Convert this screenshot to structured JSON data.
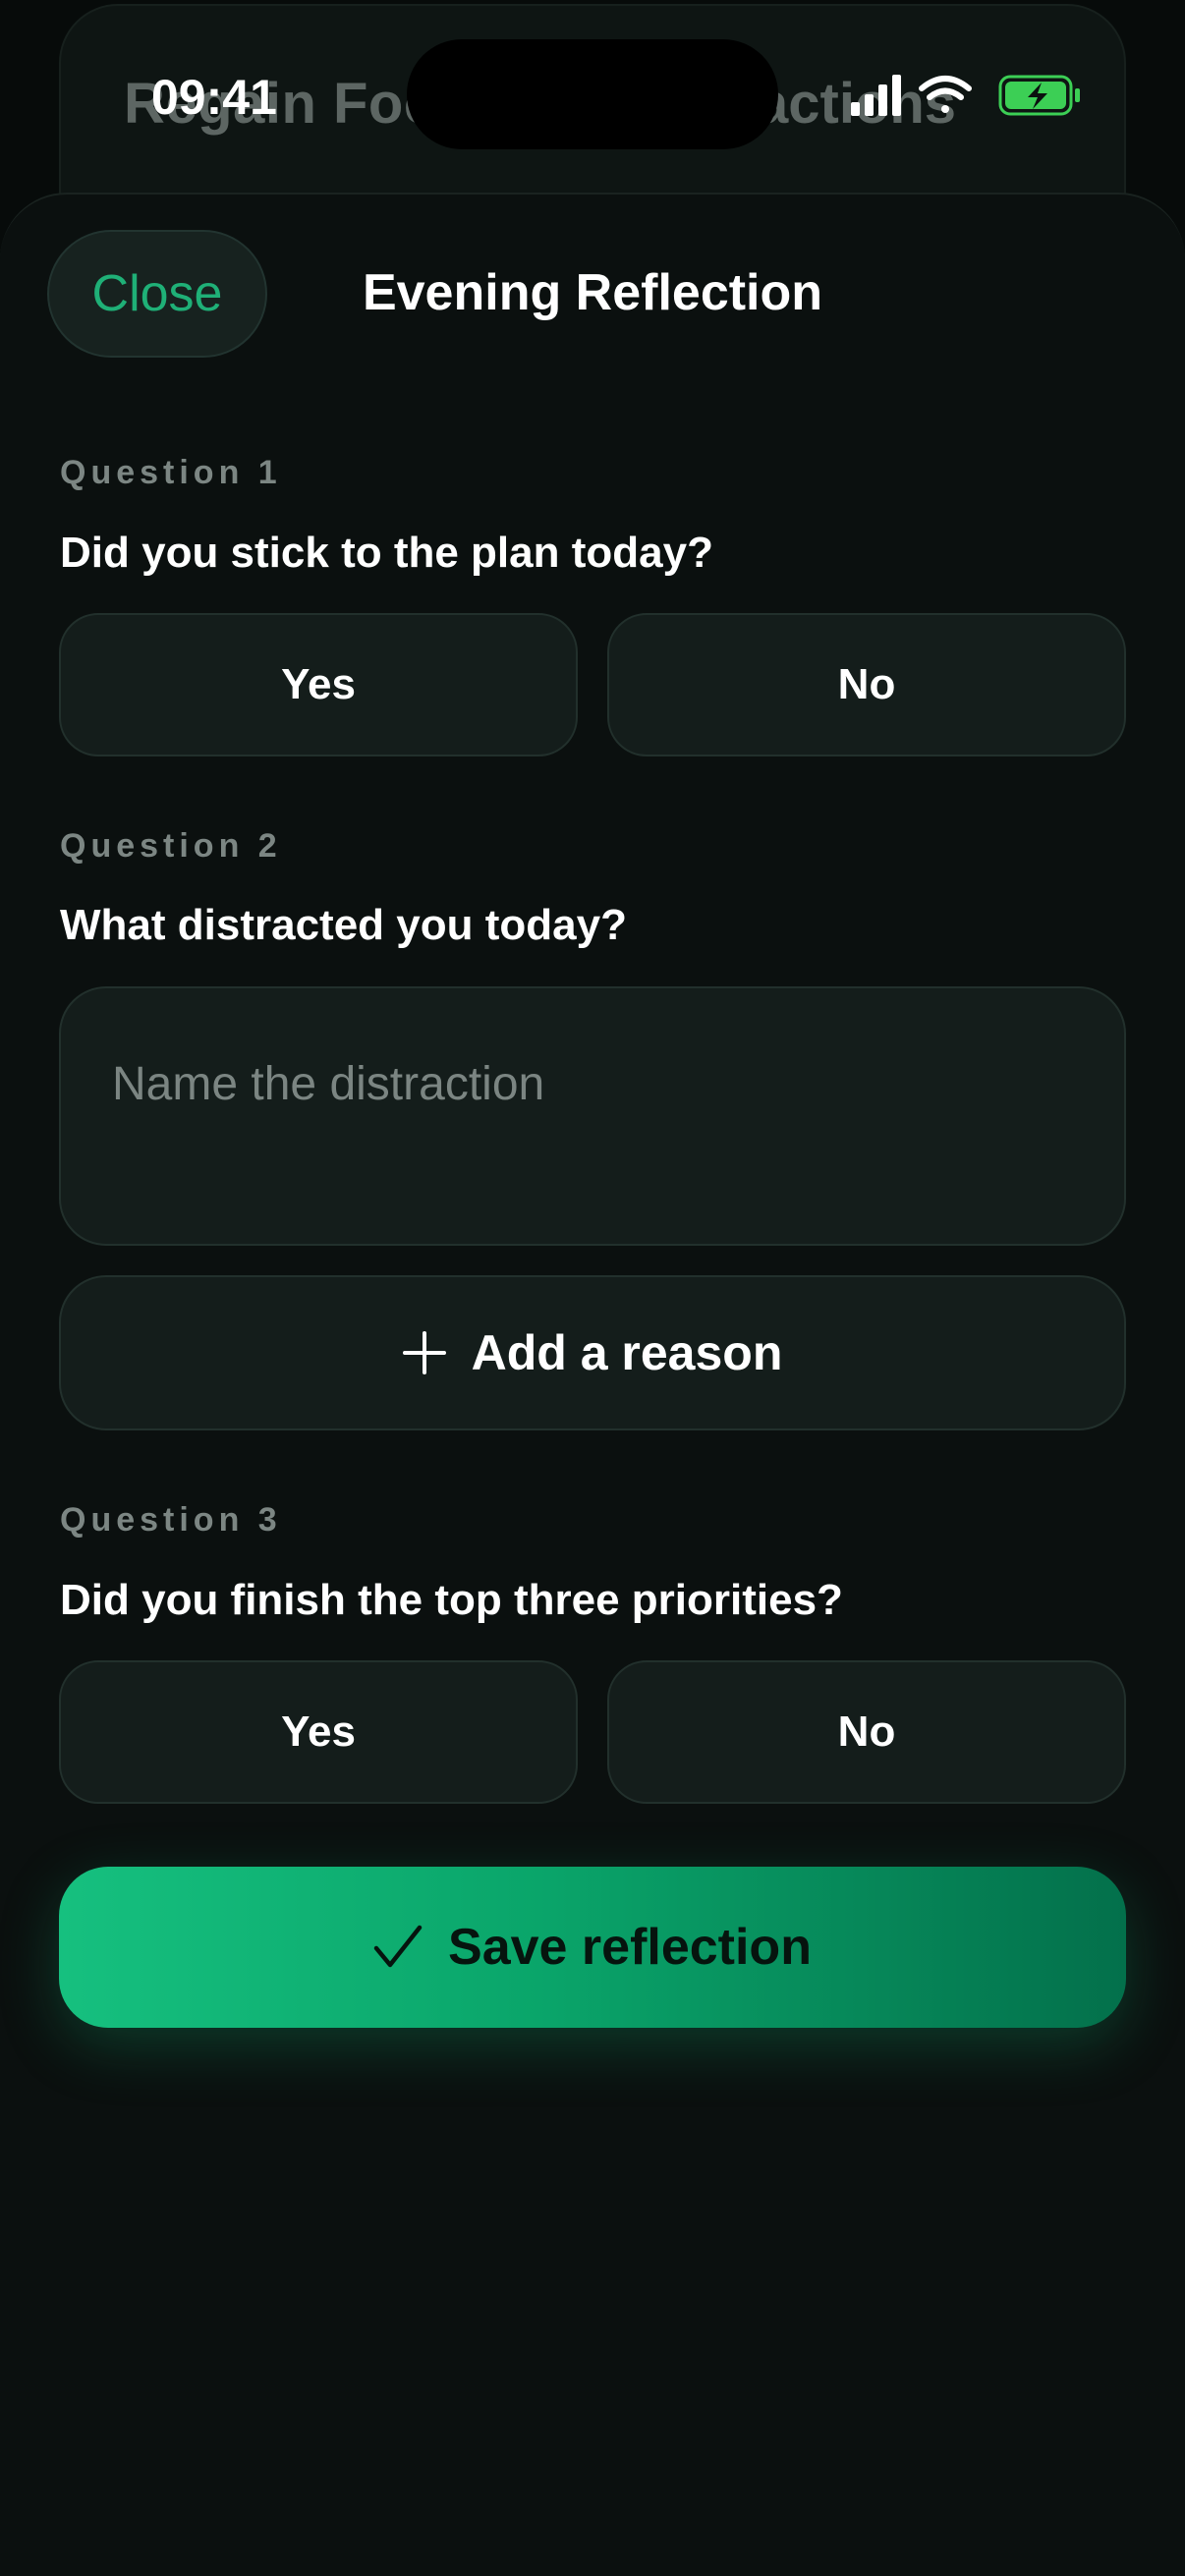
{
  "status_bar": {
    "time": "09:41"
  },
  "background": {
    "title_left": "Regain Foc",
    "title_right": "actions"
  },
  "sheet": {
    "close_label": "Close",
    "title": "Evening Reflection"
  },
  "questions": [
    {
      "label": "Question 1",
      "text": "Did you stick to the plan today?",
      "options": [
        "Yes",
        "No"
      ]
    },
    {
      "label": "Question 2",
      "text": "What distracted you today?",
      "input_placeholder": "Name the distraction",
      "input_value": "",
      "add_label": "Add a reason"
    },
    {
      "label": "Question 3",
      "text": "Did you finish the top three priorities?",
      "options": [
        "Yes",
        "No"
      ]
    }
  ],
  "save_label": "Save reflection",
  "colors": {
    "accent": "#1fb077",
    "save_gradient_start": "#16c07f",
    "save_gradient_end": "#03704b",
    "battery_fill": "#3ccf55"
  },
  "icons": [
    "signal-icon",
    "wifi-icon",
    "battery-charging-icon",
    "plus-icon",
    "checkmark-icon"
  ]
}
